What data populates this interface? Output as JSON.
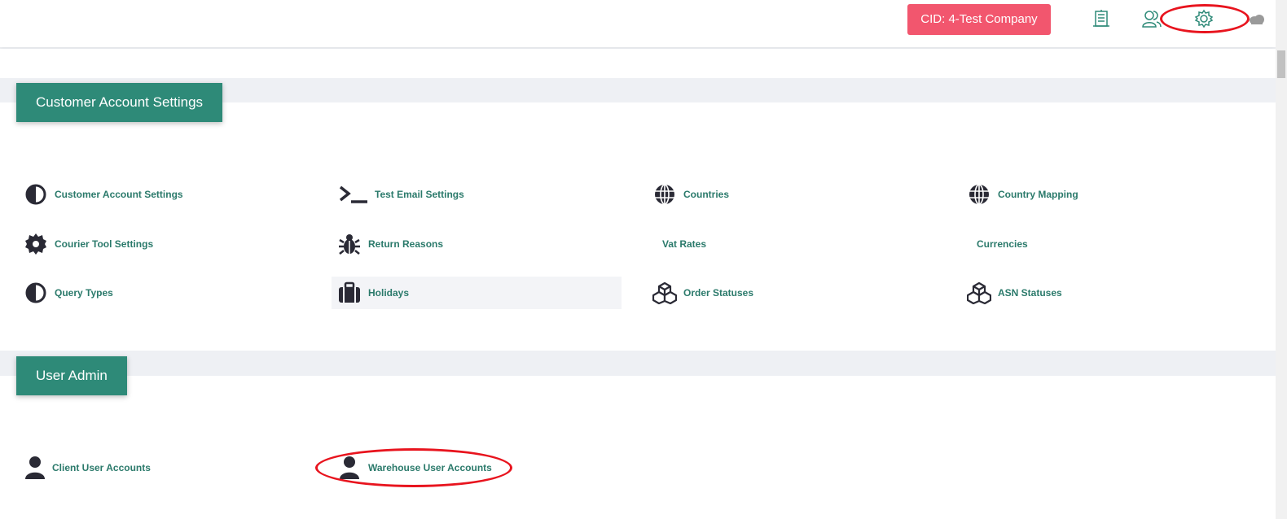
{
  "header": {
    "cid_label": "CID: 4-Test Company",
    "icons": [
      "warehouse-icon",
      "users-icon",
      "settings-icon",
      "cloud-icon"
    ],
    "accent_color": "#2e8a78",
    "badge_color": "#f2566e"
  },
  "sections": {
    "customer": {
      "title": "Customer Account Settings",
      "items": [
        {
          "label": "Customer Account Settings",
          "icon": "half-circle-icon"
        },
        {
          "label": "Test Email Settings",
          "icon": "terminal-icon"
        },
        {
          "label": "Countries",
          "icon": "globe-icon"
        },
        {
          "label": "Country Mapping",
          "icon": "globe-icon"
        },
        {
          "label": "Courier Tool Settings",
          "icon": "gear-icon"
        },
        {
          "label": "Return Reasons",
          "icon": "bug-icon"
        },
        {
          "label": "Vat Rates",
          "icon": ""
        },
        {
          "label": "Currencies",
          "icon": ""
        },
        {
          "label": "Query Types",
          "icon": "half-circle-icon"
        },
        {
          "label": "Holidays",
          "icon": "suitcase-icon"
        },
        {
          "label": "Order Statuses",
          "icon": "cubes-icon"
        },
        {
          "label": "ASN Statuses",
          "icon": "cubes-icon"
        }
      ]
    },
    "user_admin": {
      "title": "User Admin",
      "items": [
        {
          "label": "Client User Accounts",
          "icon": "user-icon"
        },
        {
          "label": "Warehouse User Accounts",
          "icon": "user-icon"
        }
      ]
    }
  }
}
